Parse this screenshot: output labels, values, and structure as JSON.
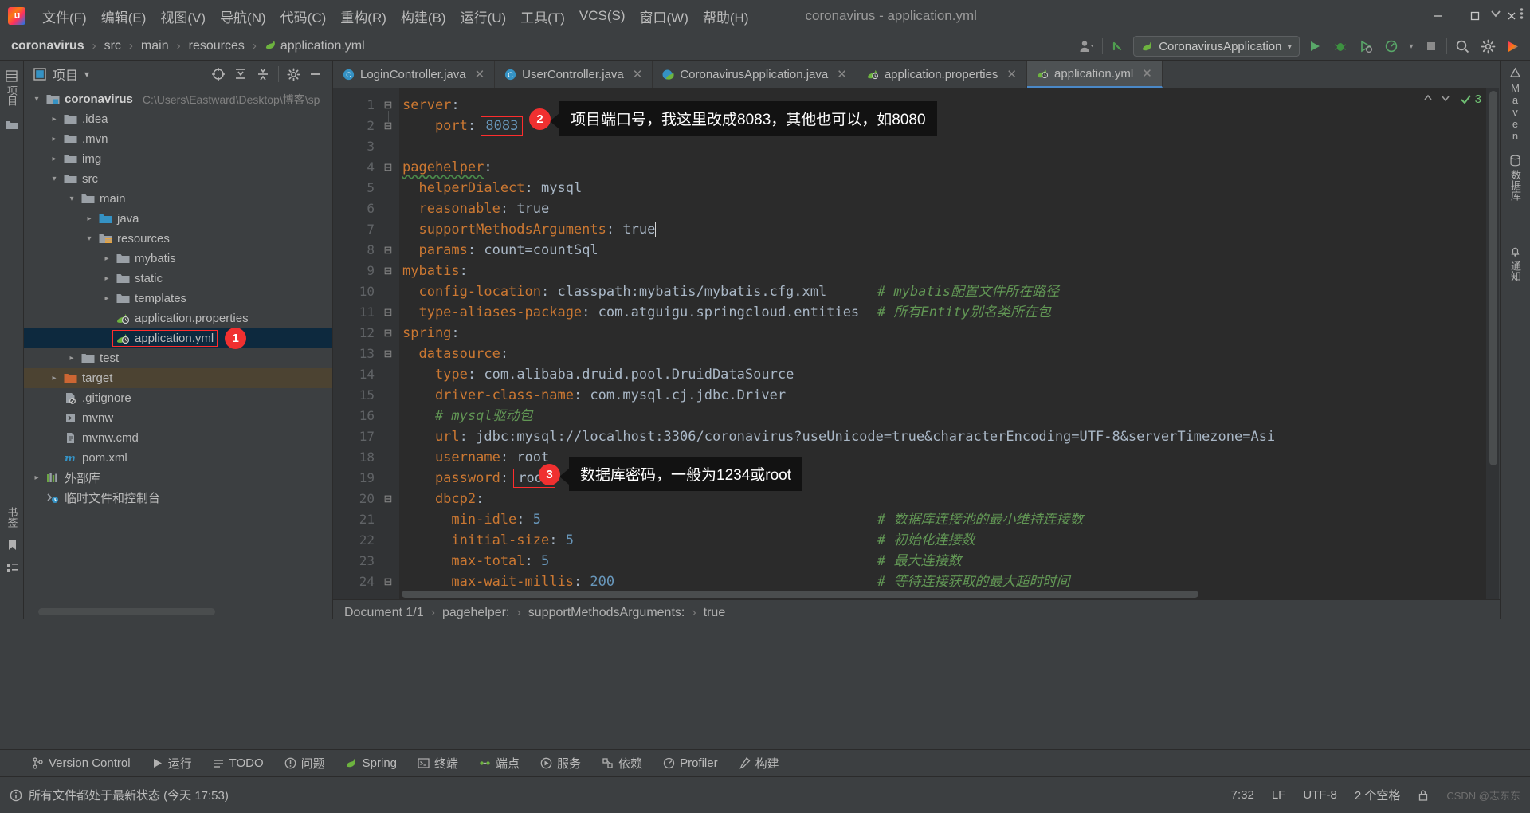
{
  "window": {
    "title": "coronavirus - application.yml",
    "minimize_label": "—",
    "maximize_label": "❐",
    "close_label": "✕"
  },
  "menu": {
    "items": [
      "文件(F)",
      "编辑(E)",
      "视图(V)",
      "导航(N)",
      "代码(C)",
      "重构(R)",
      "构建(B)",
      "运行(U)",
      "工具(T)",
      "VCS(S)",
      "窗口(W)",
      "帮助(H)"
    ]
  },
  "navbar": {
    "crumbs": [
      "coronavirus",
      "src",
      "main",
      "resources",
      "application.yml"
    ],
    "separator": "›",
    "run_config": "CoronavirusApplication",
    "run_config_caret": "▾"
  },
  "left_strip": {
    "project_label": "项目",
    "structure_label": "结构"
  },
  "project_panel": {
    "title": "项目",
    "caret": "▾",
    "tree": [
      {
        "depth": 0,
        "arrow": "⌄",
        "icon": "module-folder-icon",
        "label": "coronavirus",
        "bold": true,
        "path": "C:\\Users\\Eastward\\Desktop\\博客\\sp"
      },
      {
        "depth": 1,
        "arrow": "›",
        "icon": "folder-icon",
        "label": ".idea"
      },
      {
        "depth": 1,
        "arrow": "›",
        "icon": "folder-icon",
        "label": ".mvn"
      },
      {
        "depth": 1,
        "arrow": "›",
        "icon": "folder-icon",
        "label": "img"
      },
      {
        "depth": 1,
        "arrow": "⌄",
        "icon": "folder-icon",
        "label": "src"
      },
      {
        "depth": 2,
        "arrow": "⌄",
        "icon": "folder-icon",
        "label": "main"
      },
      {
        "depth": 3,
        "arrow": "›",
        "icon": "source-folder-icon",
        "label": "java"
      },
      {
        "depth": 3,
        "arrow": "⌄",
        "icon": "resource-folder-icon",
        "label": "resources"
      },
      {
        "depth": 4,
        "arrow": "›",
        "icon": "folder-icon",
        "label": "mybatis"
      },
      {
        "depth": 4,
        "arrow": "›",
        "icon": "folder-icon",
        "label": "static"
      },
      {
        "depth": 4,
        "arrow": "›",
        "icon": "folder-icon",
        "label": "templates"
      },
      {
        "depth": 4,
        "arrow": "",
        "icon": "spring-file-icon",
        "label": "application.properties"
      },
      {
        "depth": 4,
        "arrow": "",
        "icon": "spring-file-icon",
        "label": "application.yml",
        "selected": true,
        "boxed": true,
        "badge": "1"
      },
      {
        "depth": 2,
        "arrow": "›",
        "icon": "folder-icon",
        "label": "test"
      },
      {
        "depth": 1,
        "arrow": "›",
        "icon": "excluded-folder-icon",
        "label": "target",
        "excluded": true
      },
      {
        "depth": 1,
        "arrow": "",
        "icon": "gitignore-icon",
        "label": ".gitignore"
      },
      {
        "depth": 1,
        "arrow": "",
        "icon": "script-icon",
        "label": "mvnw"
      },
      {
        "depth": 1,
        "arrow": "",
        "icon": "cmd-file-icon",
        "label": "mvnw.cmd"
      },
      {
        "depth": 1,
        "arrow": "",
        "icon": "maven-icon",
        "label": "pom.xml"
      },
      {
        "depth": 0,
        "arrow": "›",
        "icon": "external-libraries-icon",
        "label": "外部库"
      },
      {
        "depth": 0,
        "arrow": "",
        "icon": "scratches-icon",
        "label": "临时文件和控制台"
      }
    ]
  },
  "editor_tabs": [
    {
      "label": "LoginController.java",
      "icon": "java-class-icon",
      "active": false,
      "close": "✕"
    },
    {
      "label": "UserController.java",
      "icon": "java-class-icon",
      "active": false,
      "close": "✕"
    },
    {
      "label": "CoronavirusApplication.java",
      "icon": "spring-boot-class-icon",
      "active": false,
      "close": "✕"
    },
    {
      "label": "application.properties",
      "icon": "spring-file-icon",
      "active": false,
      "close": "✕"
    },
    {
      "label": "application.yml",
      "icon": "spring-file-icon",
      "active": true,
      "close": "✕"
    }
  ],
  "editor": {
    "inspection_count": "3",
    "lines": [
      {
        "n": 1,
        "fold": "⊟",
        "segs": [
          {
            "t": "server",
            "c": "key"
          },
          {
            "t": ":",
            "c": "plain"
          }
        ]
      },
      {
        "n": 2,
        "fold": "⊟",
        "indent": 2,
        "segs": [
          {
            "t": "    port",
            "c": "key"
          },
          {
            "t": ": ",
            "c": "plain"
          },
          {
            "t": "8083",
            "c": "num",
            "boxed": true
          }
        ]
      },
      {
        "n": 3,
        "fold": "",
        "segs": []
      },
      {
        "n": 4,
        "fold": "⊟",
        "segs": [
          {
            "t": "pagehelper",
            "c": "key",
            "squiggle": true
          },
          {
            "t": ":",
            "c": "plain"
          }
        ]
      },
      {
        "n": 5,
        "fold": "",
        "segs": [
          {
            "t": "  helperDialect",
            "c": "key"
          },
          {
            "t": ": ",
            "c": "plain"
          },
          {
            "t": "mysql",
            "c": "val"
          }
        ]
      },
      {
        "n": 6,
        "fold": "",
        "segs": [
          {
            "t": "  reasonable",
            "c": "key"
          },
          {
            "t": ": ",
            "c": "plain"
          },
          {
            "t": "true",
            "c": "val"
          }
        ]
      },
      {
        "n": 7,
        "fold": "",
        "segs": [
          {
            "t": "  supportMethodsArguments",
            "c": "key"
          },
          {
            "t": ": ",
            "c": "plain"
          },
          {
            "t": "true",
            "c": "val",
            "caret": true
          }
        ]
      },
      {
        "n": 8,
        "fold": "⊟",
        "segs": [
          {
            "t": "  params",
            "c": "key"
          },
          {
            "t": ": ",
            "c": "plain"
          },
          {
            "t": "count=countSql",
            "c": "val"
          }
        ]
      },
      {
        "n": 9,
        "fold": "⊟",
        "segs": [
          {
            "t": "mybatis",
            "c": "key"
          },
          {
            "t": ":",
            "c": "plain"
          }
        ]
      },
      {
        "n": 10,
        "fold": "",
        "segs": [
          {
            "t": "  config-location",
            "c": "key"
          },
          {
            "t": ": ",
            "c": "plain"
          },
          {
            "t": "classpath:mybatis/mybatis.cfg.xml",
            "c": "val"
          }
        ],
        "comment": "# mybatis配置文件所在路径"
      },
      {
        "n": 11,
        "fold": "⊟",
        "segs": [
          {
            "t": "  type-aliases-package",
            "c": "key"
          },
          {
            "t": ": ",
            "c": "plain"
          },
          {
            "t": "com.atguigu.springcloud.entities",
            "c": "val"
          }
        ],
        "comment": "# 所有Entity别名类所在包"
      },
      {
        "n": 12,
        "fold": "⊟",
        "segs": [
          {
            "t": "spring",
            "c": "key"
          },
          {
            "t": ":",
            "c": "plain"
          }
        ]
      },
      {
        "n": 13,
        "fold": "⊟",
        "segs": [
          {
            "t": "  datasource",
            "c": "key"
          },
          {
            "t": ":",
            "c": "plain"
          }
        ]
      },
      {
        "n": 14,
        "fold": "",
        "segs": [
          {
            "t": "    type",
            "c": "key"
          },
          {
            "t": ": ",
            "c": "plain"
          },
          {
            "t": "com.alibaba.druid.pool.DruidDataSource",
            "c": "val"
          }
        ]
      },
      {
        "n": 15,
        "fold": "",
        "segs": [
          {
            "t": "    driver-class-name",
            "c": "key"
          },
          {
            "t": ": ",
            "c": "plain"
          },
          {
            "t": "com.mysql.cj.jdbc.Driver",
            "c": "val"
          }
        ]
      },
      {
        "n": 16,
        "fold": "",
        "segs": [
          {
            "t": "    # mysql驱动包",
            "c": "com"
          }
        ]
      },
      {
        "n": 17,
        "fold": "",
        "segs": [
          {
            "t": "    url",
            "c": "key"
          },
          {
            "t": ": ",
            "c": "plain"
          },
          {
            "t": "jdbc:mysql://localhost:3306/coronavirus?useUnicode=true&characterEncoding=UTF-8&serverTimezone=Asi",
            "c": "val"
          }
        ]
      },
      {
        "n": 18,
        "fold": "",
        "segs": [
          {
            "t": "    username",
            "c": "key"
          },
          {
            "t": ": ",
            "c": "plain"
          },
          {
            "t": "root",
            "c": "val"
          }
        ]
      },
      {
        "n": 19,
        "fold": "",
        "segs": [
          {
            "t": "    password",
            "c": "key"
          },
          {
            "t": ": ",
            "c": "plain"
          },
          {
            "t": "root",
            "c": "val",
            "boxed": true
          }
        ]
      },
      {
        "n": 20,
        "fold": "⊟",
        "segs": [
          {
            "t": "    dbcp2",
            "c": "key"
          },
          {
            "t": ":",
            "c": "plain"
          }
        ]
      },
      {
        "n": 21,
        "fold": "",
        "segs": [
          {
            "t": "      min-idle",
            "c": "key"
          },
          {
            "t": ": ",
            "c": "plain"
          },
          {
            "t": "5",
            "c": "num"
          }
        ],
        "comment": "# 数据库连接池的最小维持连接数"
      },
      {
        "n": 22,
        "fold": "",
        "segs": [
          {
            "t": "      initial-size",
            "c": "key"
          },
          {
            "t": ": ",
            "c": "plain"
          },
          {
            "t": "5",
            "c": "num"
          }
        ],
        "comment": "# 初始化连接数"
      },
      {
        "n": 23,
        "fold": "",
        "segs": [
          {
            "t": "      max-total",
            "c": "key"
          },
          {
            "t": ": ",
            "c": "plain"
          },
          {
            "t": "5",
            "c": "num"
          }
        ],
        "comment": "# 最大连接数"
      },
      {
        "n": 24,
        "fold": "⊟",
        "segs": [
          {
            "t": "      max-wait-millis",
            "c": "key"
          },
          {
            "t": ": ",
            "c": "plain"
          },
          {
            "t": "200",
            "c": "num"
          }
        ],
        "comment": "# 等待连接获取的最大超时时间"
      }
    ]
  },
  "annotations": [
    {
      "number": "2",
      "text": "项目端口号，我这里改成8083，其他也可以，如8080"
    },
    {
      "number": "3",
      "text": "数据库密码，一般为1234或root"
    }
  ],
  "doc_breadcrumb": {
    "document": "Document 1/1",
    "path": [
      "pagehelper:",
      "supportMethodsArguments:",
      "true"
    ],
    "separator": "›"
  },
  "right_strip": {
    "items": [
      "Maven",
      "数据库",
      "通知"
    ]
  },
  "bottom_tools": [
    {
      "label": "Version Control",
      "icon": "branch-icon"
    },
    {
      "label": "运行",
      "icon": "run-icon"
    },
    {
      "label": "TODO",
      "icon": "todo-icon"
    },
    {
      "label": "问题",
      "icon": "problems-icon"
    },
    {
      "label": "Spring",
      "icon": "spring-icon"
    },
    {
      "label": "终端",
      "icon": "terminal-icon"
    },
    {
      "label": "端点",
      "icon": "endpoints-icon"
    },
    {
      "label": "服务",
      "icon": "services-icon"
    },
    {
      "label": "依赖",
      "icon": "dependencies-icon"
    },
    {
      "label": "Profiler",
      "icon": "profiler-icon"
    },
    {
      "label": "构建",
      "icon": "build-icon"
    }
  ],
  "status_bar": {
    "message": "所有文件都处于最新状态 (今天 17:53)",
    "caret_position": "7:32",
    "line_separator": "LF",
    "encoding": "UTF-8",
    "indent": "2 个空格",
    "lock": "🔒",
    "watermark": "CSDN @志东东"
  },
  "colors": {
    "accent": "#4a88c7",
    "badge_red": "#f03030",
    "keyword_orange": "#cc7832",
    "number_blue": "#6897bb",
    "comment_green": "#629755",
    "editor_bg": "#2b2b2b",
    "panel_bg": "#3c3f41"
  }
}
